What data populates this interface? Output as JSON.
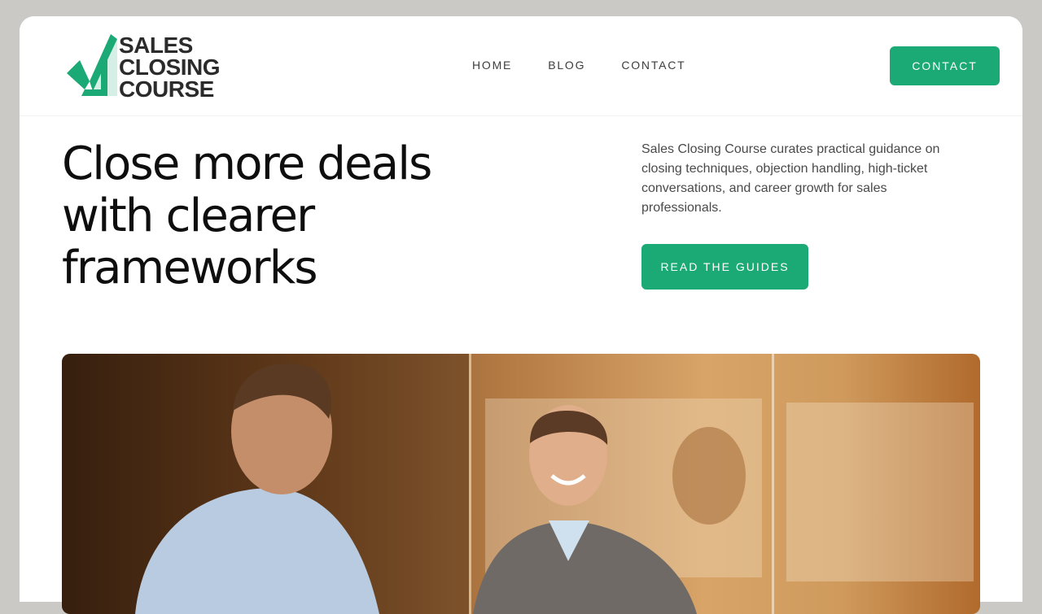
{
  "colors": {
    "accent": "#1ba975",
    "page_background": "#cbc9c5",
    "heading": "#0e0e0e",
    "body_text": "#4a4a4a"
  },
  "header": {
    "logo": {
      "line1": "SALES",
      "line2": "CLOSING",
      "line3": "COURSE",
      "icon": "checkmark-logo-icon"
    },
    "nav": [
      {
        "label": "HOME"
      },
      {
        "label": "BLOG"
      },
      {
        "label": "CONTACT"
      }
    ],
    "cta_label": "CONTACT"
  },
  "hero": {
    "headline_line1": "Close more deals",
    "headline_line2": "with clearer",
    "headline_line3": "frameworks",
    "description": "Sales Closing Course curates practical guidance on closing techniques, objection handling, high-ticket conversations, and career growth for sales professionals.",
    "cta_label": "READ THE GUIDES"
  }
}
